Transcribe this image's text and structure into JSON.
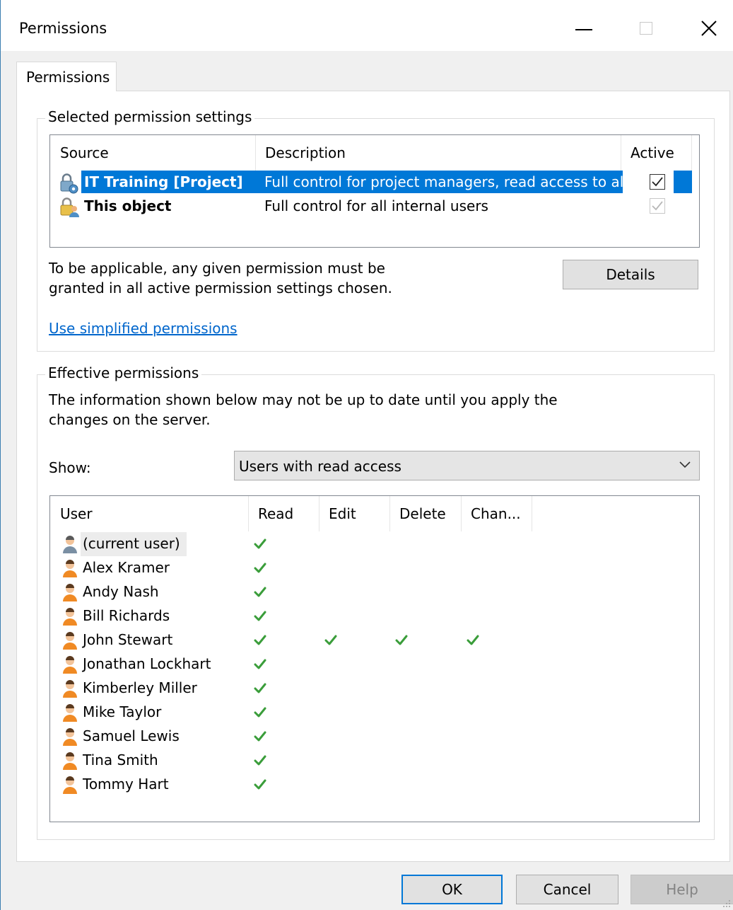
{
  "window": {
    "title": "Permissions",
    "minimize_icon": "minimize-icon",
    "maximize_icon": "maximize-icon",
    "close_icon": "close-icon"
  },
  "tabs": [
    {
      "label": "Permissions",
      "selected": true
    }
  ],
  "selected_settings": {
    "group_label": "Selected permission settings",
    "columns": {
      "source": "Source",
      "description": "Description",
      "active": "Active"
    },
    "rows": [
      {
        "source": "IT Training [Project]",
        "description": "Full control for project managers, read access to all",
        "active": true,
        "enabled": true,
        "selected": true,
        "icon": "project-lock-icon"
      },
      {
        "source": "This object",
        "description": "Full control for all internal users",
        "active": true,
        "enabled": false,
        "selected": false,
        "icon": "user-lock-icon"
      }
    ],
    "note_line1": "To be applicable, any given permission must be",
    "note_line2": "granted in all active permission settings chosen.",
    "details_button": "Details",
    "simplified_link": "Use simplified permissions"
  },
  "effective": {
    "group_label": "Effective permissions",
    "info_line1": "The information shown below may not be up to date until you apply the",
    "info_line2": "changes on the server.",
    "show_label": "Show:",
    "show_value": "Users with read access",
    "columns": {
      "user": "User",
      "read": "Read",
      "edit": "Edit",
      "delete": "Delete",
      "change": "Chan..."
    },
    "users": [
      {
        "name": "(current user)",
        "read": true,
        "edit": false,
        "delete": false,
        "change": false,
        "current": true
      },
      {
        "name": "Alex Kramer",
        "read": true,
        "edit": false,
        "delete": false,
        "change": false
      },
      {
        "name": "Andy Nash",
        "read": true,
        "edit": false,
        "delete": false,
        "change": false
      },
      {
        "name": "Bill Richards",
        "read": true,
        "edit": false,
        "delete": false,
        "change": false
      },
      {
        "name": "John Stewart",
        "read": true,
        "edit": true,
        "delete": true,
        "change": true
      },
      {
        "name": "Jonathan Lockhart",
        "read": true,
        "edit": false,
        "delete": false,
        "change": false
      },
      {
        "name": "Kimberley Miller",
        "read": true,
        "edit": false,
        "delete": false,
        "change": false
      },
      {
        "name": "Mike Taylor",
        "read": true,
        "edit": false,
        "delete": false,
        "change": false
      },
      {
        "name": "Samuel Lewis",
        "read": true,
        "edit": false,
        "delete": false,
        "change": false
      },
      {
        "name": "Tina Smith",
        "read": true,
        "edit": false,
        "delete": false,
        "change": false
      },
      {
        "name": "Tommy Hart",
        "read": true,
        "edit": false,
        "delete": false,
        "change": false
      }
    ]
  },
  "footer": {
    "ok": "OK",
    "cancel": "Cancel",
    "help": "Help"
  },
  "colors": {
    "accent": "#0078d7",
    "check_green": "#3a9d3a",
    "link": "#0066cc"
  }
}
